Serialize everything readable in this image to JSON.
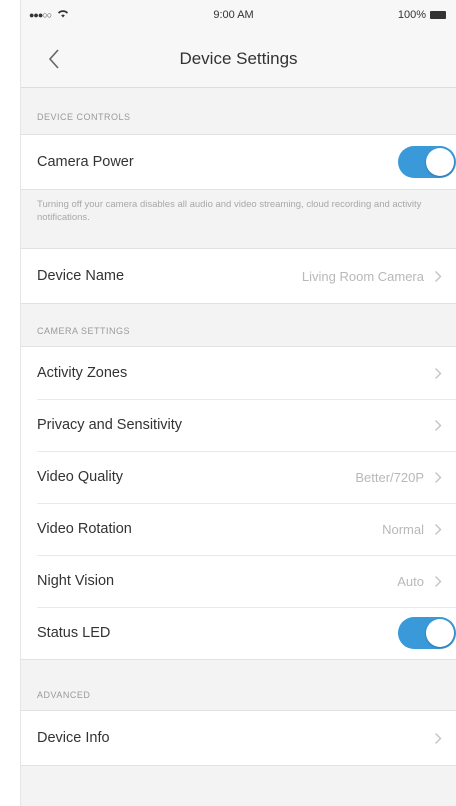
{
  "status_bar": {
    "signal": "●●●○○",
    "time": "9:00 AM",
    "battery_percent": "100%"
  },
  "nav": {
    "title": "Device Settings",
    "back_icon": "chevron-left-icon"
  },
  "sections": {
    "device_controls": {
      "header": "DEVICE CONTROLS",
      "camera_power_label": "Camera Power",
      "camera_power_on": true,
      "footnote": "Turning off your camera disables all audio and video streaming, cloud recording and activity notifications.",
      "device_name_label": "Device Name",
      "device_name_value": "Living Room Camera"
    },
    "camera_settings": {
      "header": "CAMERA SETTINGS",
      "activity_zones_label": "Activity Zones",
      "privacy_label": "Privacy and Sensitivity",
      "video_quality_label": "Video Quality",
      "video_quality_value": "Better/720P",
      "video_rotation_label": "Video Rotation",
      "video_rotation_value": "Normal",
      "night_vision_label": "Night Vision",
      "night_vision_value": "Auto",
      "status_led_label": "Status LED",
      "status_led_on": true
    },
    "advanced": {
      "header": "ADVANCED",
      "device_info_label": "Device Info"
    }
  },
  "colors": {
    "toggle_on": "#3a9ad9",
    "background": "#f3f3f4"
  }
}
